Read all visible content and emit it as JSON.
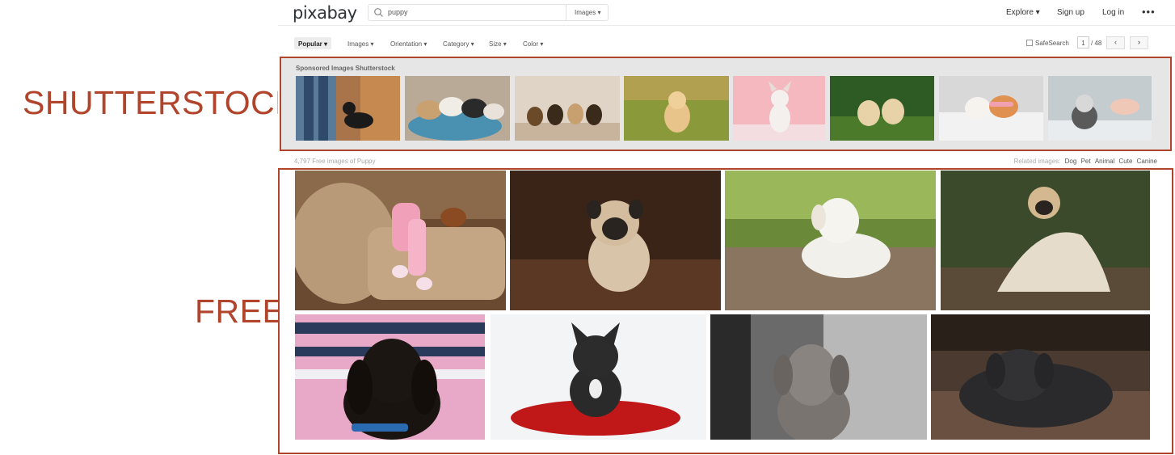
{
  "annotations": {
    "shutterstock": "SHUTTERSTOCK",
    "free": "FREE"
  },
  "header": {
    "logo": "pixabay",
    "search_value": "puppy",
    "search_type": "Images ▾",
    "nav": {
      "explore": "Explore ▾",
      "signup": "Sign up",
      "login": "Log in",
      "more": "•••"
    }
  },
  "filters": {
    "items": [
      "Popular ▾",
      "Images ▾",
      "Orientation ▾",
      "Category ▾",
      "Size ▾",
      "Color ▾"
    ],
    "safesearch": "SafeSearch",
    "page_current": "1",
    "page_total": "/ 48",
    "prev": "‹",
    "next": "›"
  },
  "sponsored": {
    "title": "Sponsored Images Shutterstock",
    "thumbs": [
      {
        "alt": "puppy on leash"
      },
      {
        "alt": "puppies in basket"
      },
      {
        "alt": "row of puppies"
      },
      {
        "alt": "golden puppy in grass"
      },
      {
        "alt": "french bulldog on pink"
      },
      {
        "alt": "two puppies running"
      },
      {
        "alt": "puppy with kitten"
      },
      {
        "alt": "husky puppy high five"
      }
    ]
  },
  "results": {
    "count": "4,797 Free images of Puppy",
    "related_label": "Related images:",
    "related": [
      "Dog",
      "Pet",
      "Animal",
      "Cute",
      "Canine"
    ],
    "photos": [
      {
        "alt": "puppy on sofa with child"
      },
      {
        "alt": "pug puppy on wooden floor"
      },
      {
        "alt": "white labrador puppy on deck"
      },
      {
        "alt": "pug wrapped in blanket"
      },
      {
        "alt": "dachshund puppy"
      },
      {
        "alt": "french bulldog on red cushion"
      },
      {
        "alt": "weimaraner puppy"
      },
      {
        "alt": "black puppy lying down"
      }
    ]
  },
  "colors": {
    "annotation": "#b0452c",
    "sponsored_bg": "#e6e6e6"
  }
}
